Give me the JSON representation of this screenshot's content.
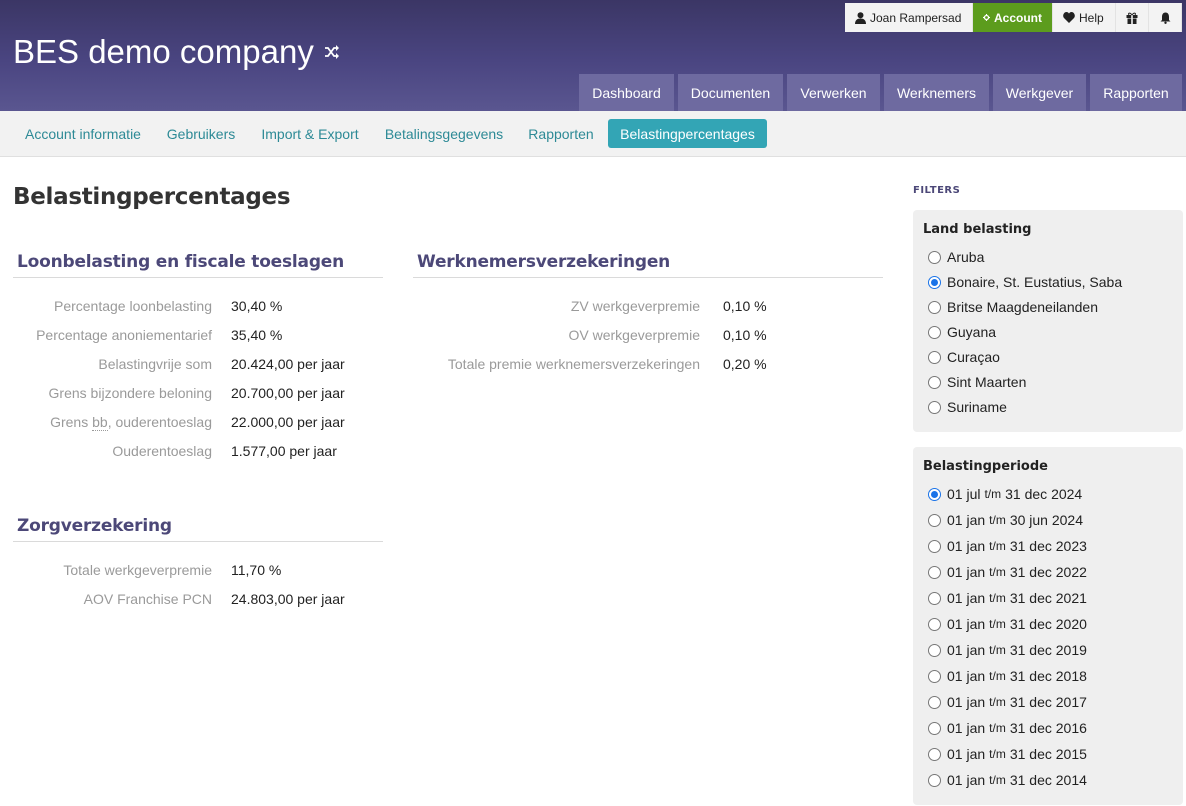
{
  "header": {
    "company": "BES demo company",
    "user_name": "Joan Rampersad",
    "account_label": "Account",
    "help_label": "Help",
    "nav": [
      "Dashboard",
      "Documenten",
      "Verwerken",
      "Werknemers",
      "Werkgever",
      "Rapporten"
    ],
    "colors": {
      "header": "#4a4581",
      "nav": "#6e6aa0",
      "account": "#5c9c1d",
      "active_sub": "#33a5b5"
    }
  },
  "subnav": {
    "items": [
      "Account informatie",
      "Gebruikers",
      "Import & Export",
      "Betalingsgegevens",
      "Rapporten",
      "Belastingpercentages"
    ],
    "active": "Belastingpercentages"
  },
  "page": {
    "title": "Belastingpercentages",
    "loon": {
      "title": "Loonbelasting en fiscale toeslagen",
      "rows": [
        {
          "label": "Percentage loonbelasting",
          "value": "30,40 %"
        },
        {
          "label": "Percentage anoniementarief",
          "value": "35,40 %"
        },
        {
          "label": "Belastingvrije som",
          "value": "20.424,00 per jaar"
        },
        {
          "label": "Grens bijzondere beloning",
          "value": "20.700,00 per jaar"
        },
        {
          "label_abbr": "bb",
          "label_rest": ", ouderentoeslag",
          "label_prefix": "Grens ",
          "value": "22.000,00 per jaar"
        },
        {
          "label": "Ouderentoeslag",
          "value": "1.577,00 per jaar"
        }
      ]
    },
    "zorg": {
      "title": "Zorgverzekering",
      "rows": [
        {
          "label": "Totale werkgeverpremie",
          "value": "11,70 %"
        },
        {
          "label": "AOV Franchise PCN",
          "value": "24.803,00 per jaar"
        }
      ]
    },
    "werk": {
      "title": "Werknemersverzekeringen",
      "rows": [
        {
          "label": "ZV werkgeverpremie",
          "value": "0,10 %"
        },
        {
          "label": "OV werkgeverpremie",
          "value": "0,10 %"
        },
        {
          "label": "Totale premie werknemersverzekeringen",
          "value": "0,20 %"
        }
      ]
    }
  },
  "filters": {
    "heading": "FILTERS",
    "land": {
      "title": "Land belasting",
      "options": [
        "Aruba",
        "Bonaire, St. Eustatius, Saba",
        "Britse Maagdeneilanden",
        "Guyana",
        "Curaçao",
        "Sint Maarten",
        "Suriname"
      ],
      "selected": 1
    },
    "periode": {
      "title": "Belastingperiode",
      "separator": "t/m",
      "options": [
        {
          "from": "01 jul",
          "to": "31 dec 2024"
        },
        {
          "from": "01 jan",
          "to": "30 jun 2024"
        },
        {
          "from": "01 jan",
          "to": "31 dec 2023"
        },
        {
          "from": "01 jan",
          "to": "31 dec 2022"
        },
        {
          "from": "01 jan",
          "to": "31 dec 2021"
        },
        {
          "from": "01 jan",
          "to": "31 dec 2020"
        },
        {
          "from": "01 jan",
          "to": "31 dec 2019"
        },
        {
          "from": "01 jan",
          "to": "31 dec 2018"
        },
        {
          "from": "01 jan",
          "to": "31 dec 2017"
        },
        {
          "from": "01 jan",
          "to": "31 dec 2016"
        },
        {
          "from": "01 jan",
          "to": "31 dec 2015"
        },
        {
          "from": "01 jan",
          "to": "31 dec 2014"
        }
      ],
      "selected": 0
    }
  }
}
